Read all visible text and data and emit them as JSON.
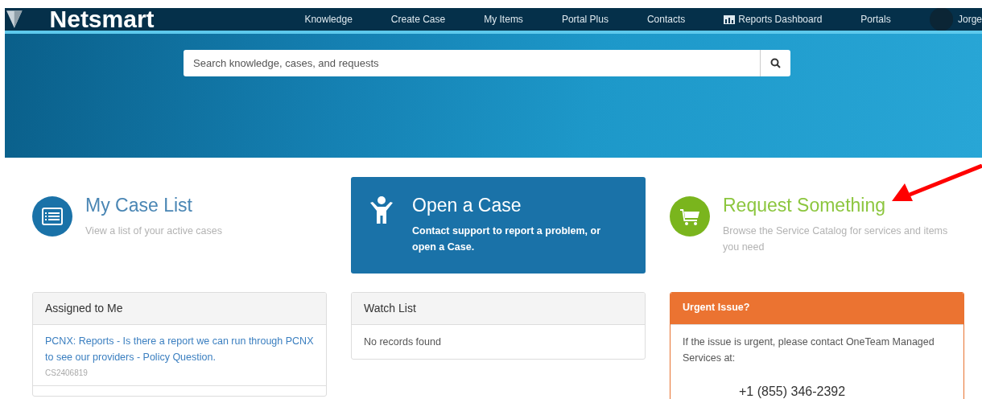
{
  "header": {
    "logo_text": "Netsmart",
    "nav": [
      {
        "label": "Knowledge",
        "kind": "text"
      },
      {
        "label": "Create Case",
        "kind": "text"
      },
      {
        "label": "My Items",
        "kind": "text"
      },
      {
        "label": "Portal Plus",
        "kind": "text"
      },
      {
        "label": "Contacts",
        "kind": "text"
      },
      {
        "label": "Reports Dashboard",
        "kind": "chart"
      },
      {
        "label": "Portals",
        "kind": "text"
      }
    ],
    "user": "Jorge"
  },
  "search": {
    "placeholder": "Search knowledge, cases, and requests"
  },
  "cards": [
    {
      "kind": "list",
      "title": "My Case List",
      "text": "View a list of your active cases"
    },
    {
      "kind": "person",
      "title": "Open a Case",
      "text": "Contact support to report a problem, or open a Case."
    },
    {
      "kind": "cart",
      "title": "Request Something",
      "text": "Browse the Service Catalog for services and items you need"
    }
  ],
  "panels": [
    {
      "kind": "list",
      "title": "Assigned to Me",
      "items": [
        {
          "title": "PCNX: Reports - Is there a report we can run through PCNX to see our providers - Policy Question.",
          "number": "CS2406819"
        }
      ]
    },
    {
      "kind": "empty",
      "title": "Watch List",
      "message": "No records found"
    },
    {
      "kind": "urgent",
      "title": "Urgent Issue?",
      "message": "If the issue is urgent, please contact OneTeam Managed Services at:",
      "phone": "+1 (855) 346-2392"
    }
  ]
}
